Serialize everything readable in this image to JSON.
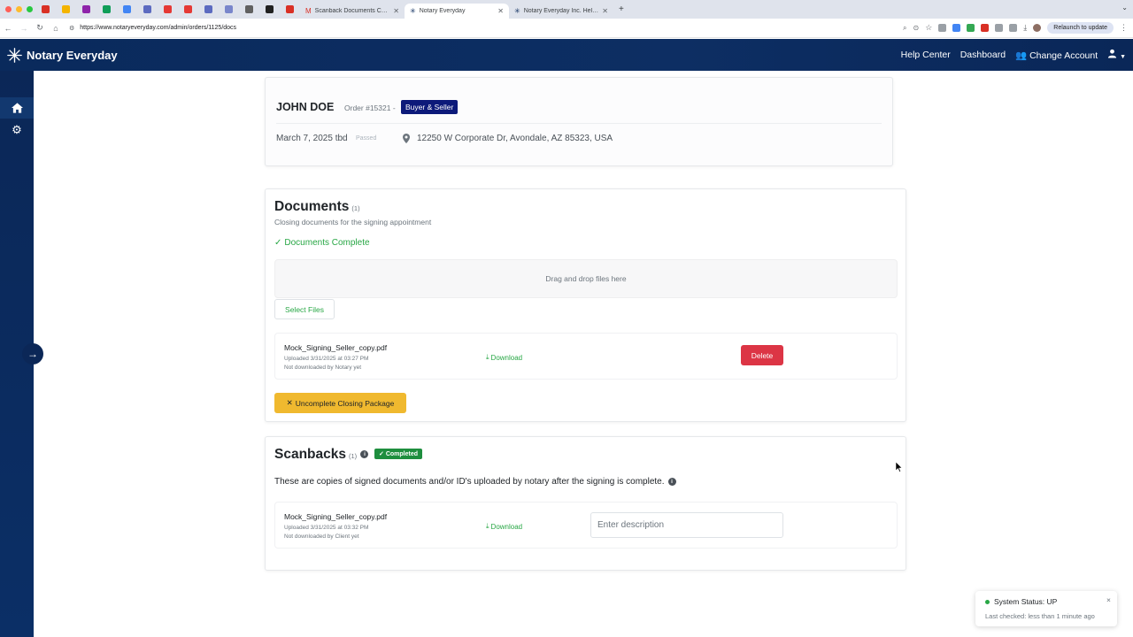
{
  "browser": {
    "tabs": [
      {
        "label": "Scanback Documents Comp",
        "active": false
      },
      {
        "label": "Notary Everyday",
        "active": true
      },
      {
        "label": "Notary Everyday Inc. Help Ce",
        "active": false
      }
    ],
    "url": "https://www.notaryeveryday.com/admin/orders/1125/docs",
    "relaunch_label": "Relaunch to update"
  },
  "navbar": {
    "brand": "Notary Everyday",
    "help_center": "Help Center",
    "dashboard": "Dashboard",
    "change_account": "Change Account"
  },
  "order": {
    "client_name": "JOHN DOE",
    "order_number": "Order #15321 -",
    "badge": "Buyer & Seller",
    "date": "March 7, 2025 tbd",
    "date_status": "Passed",
    "address": "12250 W Corporate Dr, Avondale, AZ 85323, USA"
  },
  "documents": {
    "title": "Documents",
    "count": "(1)",
    "subtitle": "Closing documents for the signing appointment",
    "complete_label": "Documents Complete",
    "dropzone_text": "Drag and drop files here",
    "select_files_label": "Select Files",
    "file": {
      "name": "Mock_Signing_Seller_copy.pdf",
      "uploaded": "Uploaded 3/31/2025 at 03:27 PM",
      "status": "Not downloaded by Notary yet",
      "download_label": "Download",
      "delete_label": "Delete"
    },
    "uncomplete_label": "Uncomplete Closing Package"
  },
  "scanbacks": {
    "title": "Scanbacks",
    "count": "(1)",
    "badge": "Completed",
    "description": "These are copies of signed documents and/or ID's uploaded by notary after the signing is complete.",
    "file": {
      "name": "Mock_Signing_Seller_copy.pdf",
      "uploaded": "Uploaded 3/31/2025 at 03:32 PM",
      "status": "Not downloaded by Client yet",
      "download_label": "Download",
      "description_placeholder": "Enter description"
    }
  },
  "toast": {
    "title": "System Status: UP",
    "subtitle": "Last checked: less than 1 minute ago",
    "close": "×"
  },
  "colors": {
    "navbar": "#0a2a5c",
    "success": "#28a745",
    "danger": "#dc3545",
    "warning": "#f0b92f",
    "badge_navy": "#0d1a7a"
  }
}
